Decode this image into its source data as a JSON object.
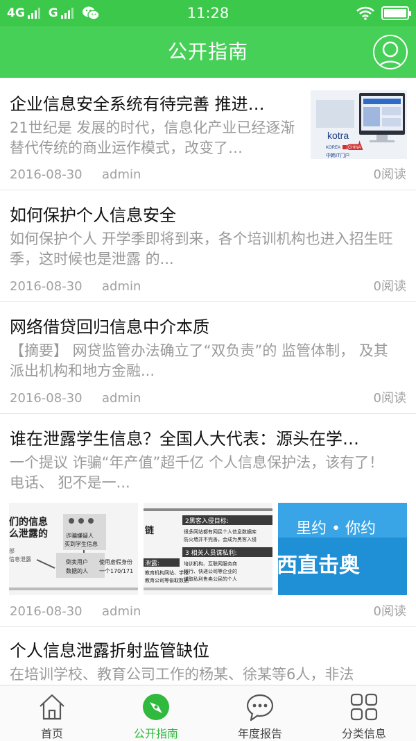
{
  "status_bar": {
    "network_1": "4G",
    "network_2": "G",
    "time": "11:28"
  },
  "header": {
    "title": "公开指南",
    "avatar_icon": "user-avatar-icon"
  },
  "articles": [
    {
      "title": "企业信息安全系统有待完善 推进…",
      "summary": "21世纪是  发展的时代，信息化产业已经逐渐替代传统的商业运作模式，改变了…",
      "date": "2016-08-30",
      "author": "admin",
      "reads": "0阅读",
      "thumb": {
        "logo": "kotra",
        "caption": "KOREA",
        "caption2": "CHINA",
        "caption3": "中韩IT门户"
      }
    },
    {
      "title": "如何保护个人信息安全",
      "summary": "如何保护个人  开学季即将到来，各个培训机构也进入招生旺季，这时候也是泄露  的...",
      "date": "2016-08-30",
      "author": "admin",
      "reads": "0阅读"
    },
    {
      "title": "网络借贷回归信息中介本质",
      "summary": "【摘要】 网贷监管办法确立了“双负责”的  监管体制，  及其派出机构和地方金融...",
      "date": "2016-08-30",
      "author": "admin",
      "reads": "0阅读"
    },
    {
      "title": "谁在泄露学生信息？全国人大代表：源头在学…",
      "summary": "一个提议  诈骗“年产值”超千亿 个人信息保护法，该有了！  电话、  犯不是一...",
      "date": "2016-08-30",
      "author": "admin",
      "reads": "0阅读",
      "images": [
        {
          "t1": "们的信息",
          "t2": "么泄露的",
          "t3": "部",
          "t4": "信息泄露",
          "t5": "诈骗嫌疑人",
          "t6": "买到学生信息",
          "t7": "倒卖用户",
          "t8": "数据的人",
          "t9": "使用虚假身份",
          "t10": "一个170/171"
        },
        {
          "t1": "2黑客入侵目标:",
          "t2": "很多网站都有网民个人信息数据库",
          "t3": "防火墙并不完善，会成为黑客入侵",
          "t4": "3 相关人员谋私利:",
          "t5": "培训机构、互联网服务商",
          "t6": "银行、快递公司等企业的",
          "t7": "谋取私利售卖公民的个人",
          "t8": "泄露:",
          "t9": "教育机构网站、学校",
          "t10": "教育公司等偷取数据",
          "t11": "链"
        },
        {
          "t1": "里约 • 你约",
          "t2": "西直击奥"
        }
      ]
    },
    {
      "title": "个人信息泄露折射监管缺位",
      "summary": "在培训学校、教育公司工作的杨某、徐某等6人，非法"
    }
  ],
  "tabbar": {
    "tabs": [
      {
        "label": "首页",
        "icon": "home-icon",
        "active": false
      },
      {
        "label": "公开指南",
        "icon": "compass-icon",
        "active": true
      },
      {
        "label": "年度报告",
        "icon": "chat-bubble-icon",
        "active": false
      },
      {
        "label": "分类信息",
        "icon": "grid-icon",
        "active": false
      }
    ]
  },
  "colors": {
    "status_bar": "#3cc84a",
    "header": "#46d057",
    "active_tab": "#2fb93d",
    "muted_text": "#9a9a9a"
  }
}
